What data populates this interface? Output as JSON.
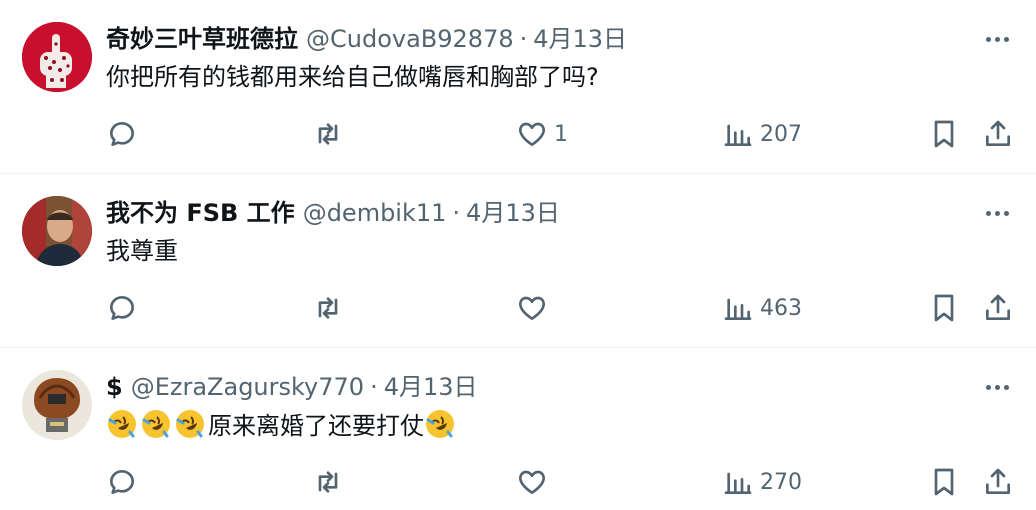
{
  "tweets": [
    {
      "name": "奇妙三叶草班德拉",
      "handle": "@CudovaB92878",
      "dot": "·",
      "time": "4月13日",
      "text": "你把所有的钱都用来给自己做嘴唇和胸部了吗?",
      "likes": "1",
      "views": "207"
    },
    {
      "name": "我不为 FSB 工作",
      "handle": "@dembik11",
      "dot": "·",
      "time": "4月13日",
      "text": "我尊重",
      "likes": "",
      "views": "463"
    },
    {
      "name": "$",
      "handle": "@EzraZagursky770",
      "dot": "·",
      "time": "4月13日",
      "text_emoji_prefix": [
        "rolling-on-floor-laughing",
        "rolling-on-floor-laughing",
        "rolling-on-floor-laughing"
      ],
      "text": "原来离婚了还要打仗",
      "text_emoji_suffix": [
        "rolling-on-floor-laughing"
      ],
      "likes": "",
      "views": "270"
    }
  ],
  "icons": {
    "reply": "reply-icon",
    "retweet": "retweet-icon",
    "like": "heart-icon",
    "views": "views-chart-icon",
    "bookmark": "bookmark-icon",
    "share": "share-icon",
    "more": "more-dots-icon"
  },
  "colors": {
    "text": "#0f1419",
    "secondary": "#536471",
    "divider": "#eff3f4",
    "avatar1_bg": "#c8102e",
    "emoji": "#f7c42f"
  }
}
